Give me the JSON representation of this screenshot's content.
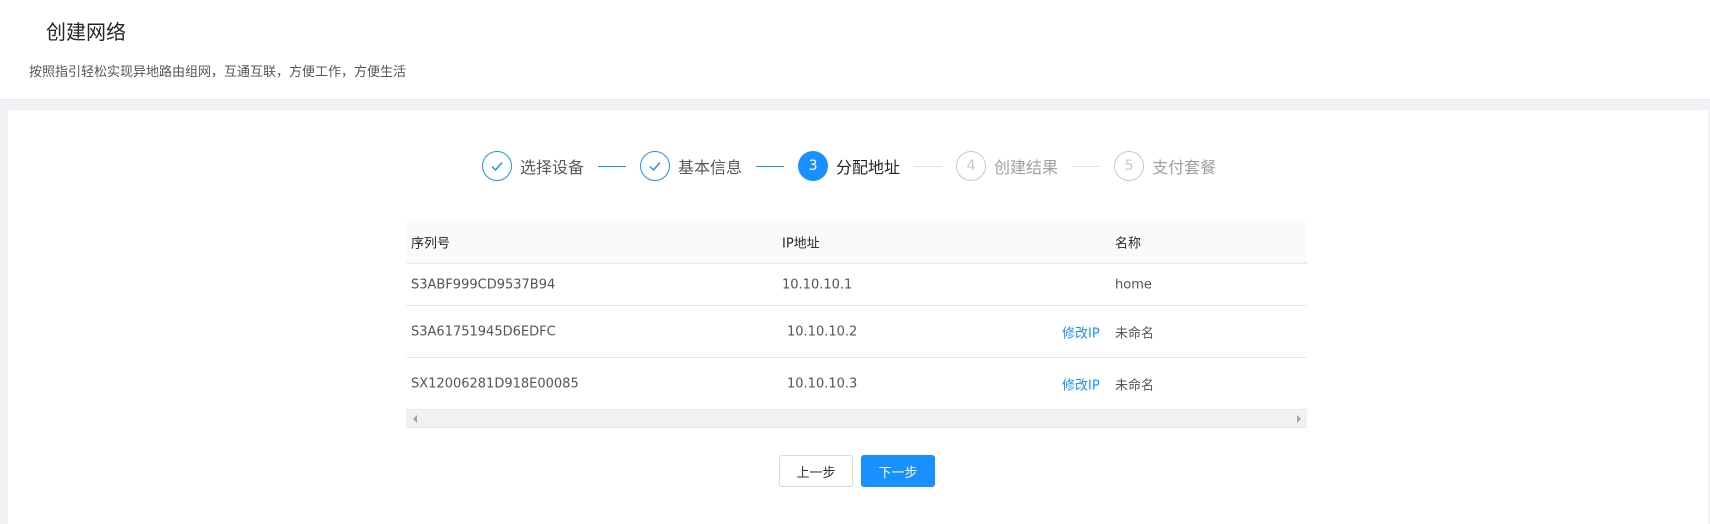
{
  "header": {
    "title": "创建网络",
    "subtitle": "按照指引轻松实现异地路由组网，互通互联，方便工作，方便生活"
  },
  "steps": [
    {
      "number": "1",
      "label": "选择设备",
      "status": "finish",
      "icon": "check-icon"
    },
    {
      "number": "2",
      "label": "基本信息",
      "status": "finish",
      "icon": "check-icon"
    },
    {
      "number": "3",
      "label": "分配地址",
      "status": "process"
    },
    {
      "number": "4",
      "label": "创建结果",
      "status": "wait"
    },
    {
      "number": "5",
      "label": "支付套餐",
      "status": "wait"
    }
  ],
  "table": {
    "columns": {
      "serial": "序列号",
      "ip": "IP地址",
      "name": "名称"
    },
    "rows": [
      {
        "serial": "S3ABF999CD9537B94",
        "ip": "10.10.10.1",
        "edit": "",
        "name": "home"
      },
      {
        "serial": "S3A61751945D6EDFC",
        "ip": "10.10.10.2",
        "edit": "修改IP",
        "name": "未命名"
      },
      {
        "serial": "SX12006281D918E00085",
        "ip": "10.10.10.3",
        "edit": "修改IP",
        "name": "未命名"
      }
    ]
  },
  "buttons": {
    "prev": "上一步",
    "next": "下一步"
  },
  "colors": {
    "primary": "#1890ff",
    "wait": "#c8c8c8"
  }
}
